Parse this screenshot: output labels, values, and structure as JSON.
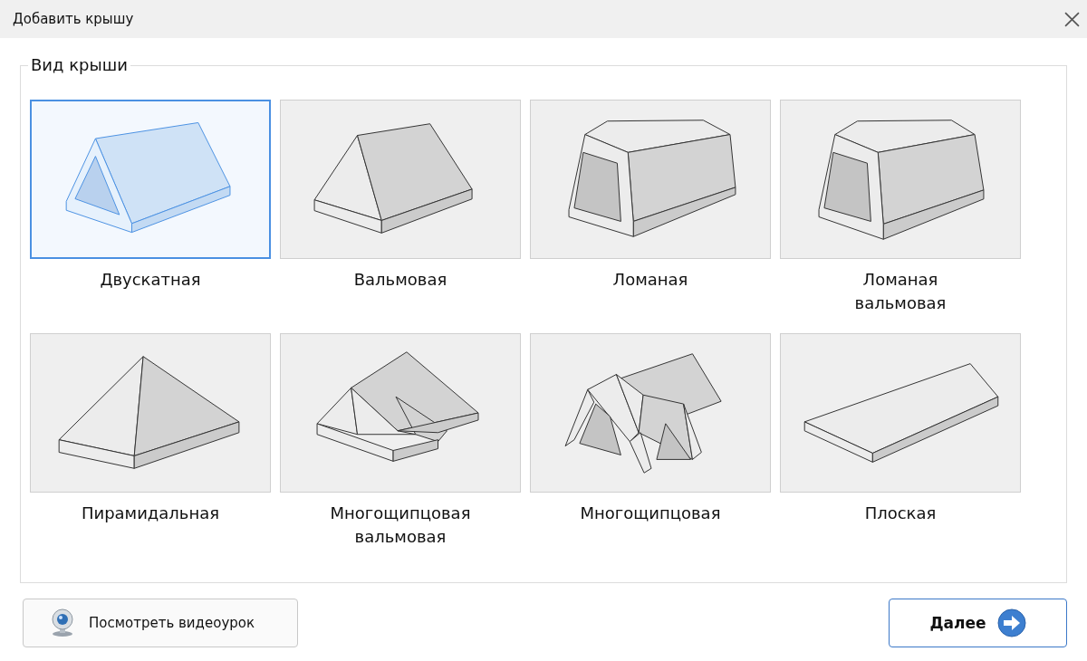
{
  "window": {
    "title": "Добавить крышу"
  },
  "group": {
    "legend": "Вид крыши"
  },
  "roof_types": [
    {
      "label": "Двускатная",
      "kind": "gable",
      "selected": true
    },
    {
      "label": "Вальмовая",
      "kind": "hip",
      "selected": false
    },
    {
      "label": "Ломаная",
      "kind": "gambrel",
      "selected": false
    },
    {
      "label": "Ломаная вальмовая",
      "kind": "gambrelhip",
      "selected": false
    },
    {
      "label": "Пирамидальная",
      "kind": "pyramid",
      "selected": false
    },
    {
      "label": "Многощипцовая вальмовая",
      "kind": "crosship",
      "selected": false
    },
    {
      "label": "Многощипцовая",
      "kind": "crossgable",
      "selected": false
    },
    {
      "label": "Плоская",
      "kind": "flat",
      "selected": false
    }
  ],
  "buttons": {
    "video": "Посмотреть видеоурок",
    "next": "Далее"
  }
}
